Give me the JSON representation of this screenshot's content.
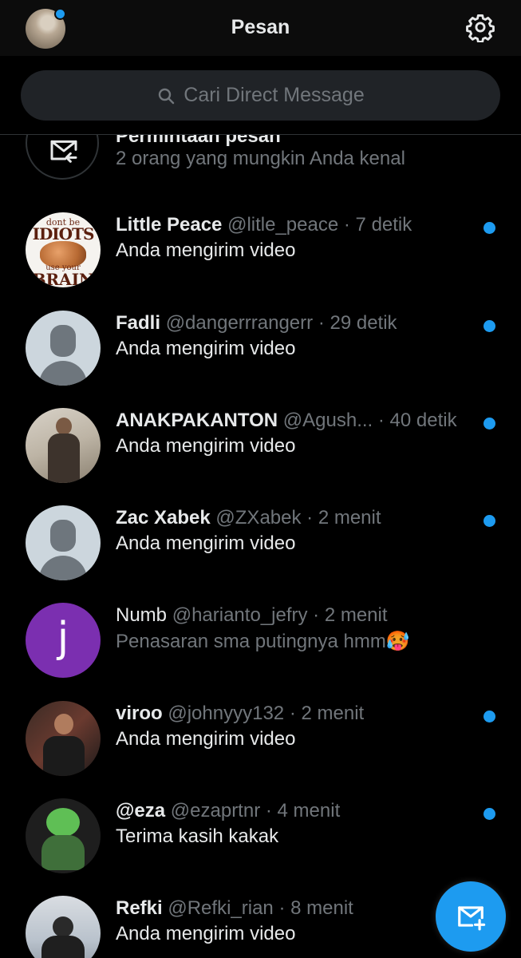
{
  "header": {
    "title": "Pesan"
  },
  "search": {
    "placeholder": "Cari Direct Message"
  },
  "request": {
    "title": "Permintaan pesan",
    "subtitle": "2 orang yang mungkin Anda kenal"
  },
  "conversations": [
    {
      "name": "Little Peace",
      "handle": "@litle_peace",
      "time": "7 detik",
      "message": "Anda mengirim video",
      "unread": true
    },
    {
      "name": "Fadli",
      "handle": "@dangerrrangerr",
      "time": "29 detik",
      "message": "Anda mengirim video",
      "unread": true
    },
    {
      "name": "ANAKPAKANTON",
      "handle": "@Agush...",
      "time": "40 detik",
      "message": "Anda mengirim video",
      "unread": true
    },
    {
      "name": "Zac Xabek",
      "handle": "@ZXabek",
      "time": "2 menit",
      "message": "Anda mengirim video",
      "unread": true
    },
    {
      "name": "Numb",
      "handle": "@harianto_jefry",
      "time": "2 menit",
      "message": "Penasaran sma putingnya hmm🥵",
      "unread": false,
      "avatar_letter": "j"
    },
    {
      "name": "viroo",
      "handle": "@johnyyy132",
      "time": "2 menit",
      "message": "Anda mengirim video",
      "unread": true
    },
    {
      "name": "@eza",
      "handle": "@ezaprtnr",
      "time": "4 menit",
      "message": "Terima kasih kakak",
      "unread": true
    },
    {
      "name": "Refki",
      "handle": "@Refki_rian",
      "time": "8 menit",
      "message": "Anda mengirim video",
      "unread": false
    }
  ],
  "avatar_art": {
    "top_small": "dont be",
    "top_big": "IDIOTS",
    "bottom_small": "use your",
    "bottom_big": "BRAIN"
  },
  "separator": "·",
  "colors": {
    "accent": "#1d9bf0",
    "background": "#000000",
    "muted": "#71767b"
  }
}
